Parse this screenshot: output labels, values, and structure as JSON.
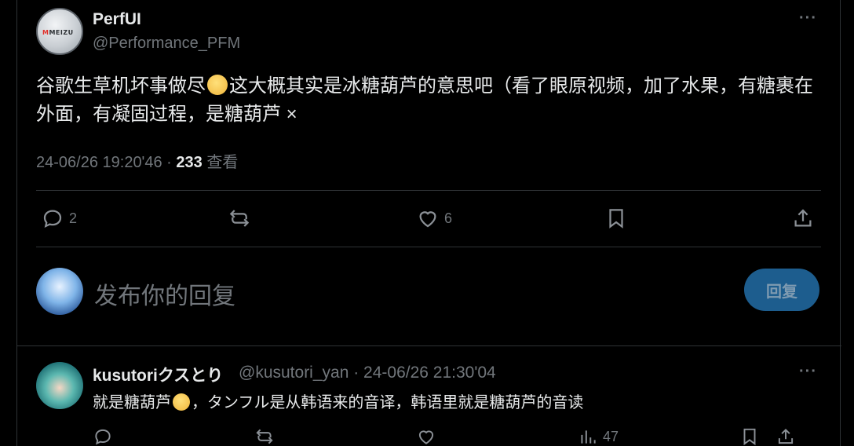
{
  "tweet": {
    "author_name": "PerfUI",
    "author_handle": "@Performance_PFM",
    "avatar_logo_m": "M",
    "avatar_logo_text": "MEIZU",
    "text_part1": "谷歌生草机坏事做尽",
    "text_part2": "这大概其实是冰糖葫芦的意思吧（看了眼原视频，加了水果，有糖裹在外面，有凝固过程，是糖葫芦 ×",
    "timestamp": "24-06/26 19:20'46",
    "separator": " · ",
    "view_count": "233",
    "view_label": "查看",
    "more_label": "···"
  },
  "actions": {
    "reply_count": "2",
    "like_count": "6"
  },
  "compose": {
    "placeholder": "发布你的回复",
    "reply_button_label": "回复"
  },
  "reply": {
    "author_name": "kusutoriクスとり",
    "author_handle": "@kusutori_yan · 24-06/26 21:30'04",
    "text_part1": "就是糖葫芦",
    "text_part2": "，タンフル是从韩语来的音译，韩语里就是糖葫芦的音读",
    "more_label": "···",
    "view_count": "47"
  },
  "colors": {
    "background": "#000000",
    "text": "#e7e9ea",
    "muted": "#71767b",
    "border": "#2f3336",
    "reply_button_bg": "#1d5d8e"
  },
  "icons": [
    "reply-icon",
    "retweet-icon",
    "like-icon",
    "bookmark-icon",
    "share-icon",
    "views-icon",
    "more-icon"
  ]
}
